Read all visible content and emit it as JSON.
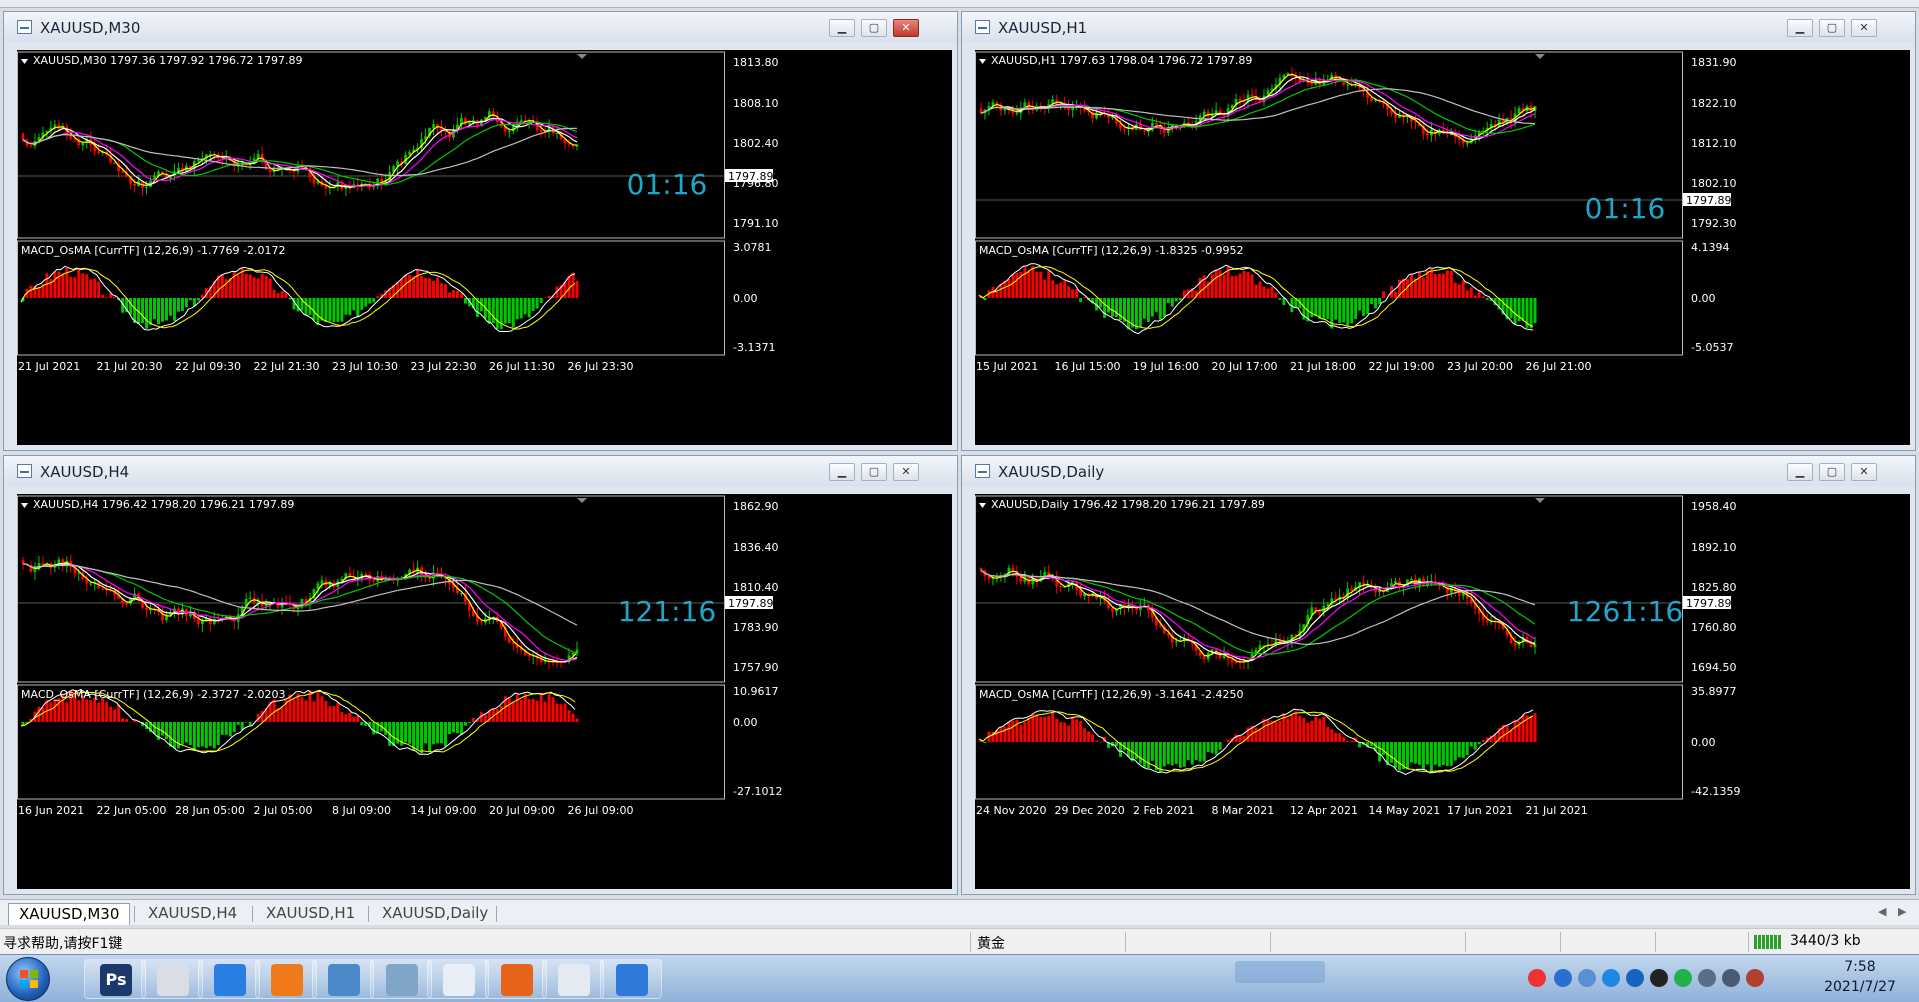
{
  "windows": [
    {
      "title": "XAUUSD,M30",
      "ohlc": "XAUUSD,M30  1797.36 1797.92 1796.72 1797.89",
      "price_axis": [
        "1813.80",
        "1808.10",
        "1802.40",
        "1796.80",
        "1791.10"
      ],
      "current_price": "1797.89",
      "countdown": "01:16",
      "macd": "MACD_OsMA [CurrTF] (12,26,9) -1.7769 -2.0172",
      "macd_axis": [
        "3.0781",
        "0.00",
        "-3.1371"
      ],
      "time_axis": [
        "21 Jul 2021",
        "21 Jul 20:30",
        "22 Jul 09:30",
        "22 Jul 21:30",
        "23 Jul 10:30",
        "23 Jul 22:30",
        "26 Jul 11:30",
        "26 Jul 23:30"
      ]
    },
    {
      "title": "XAUUSD,H1",
      "ohlc": "XAUUSD,H1  1797.63 1798.04 1796.72 1797.89",
      "price_axis": [
        "1831.90",
        "1822.10",
        "1812.10",
        "1802.10",
        "1792.30"
      ],
      "current_price": "1797.89",
      "countdown": "01:16",
      "macd": "MACD_OsMA [CurrTF] (12,26,9) -1.8325 -0.9952",
      "macd_axis": [
        "4.1394",
        "0.00",
        "-5.0537"
      ],
      "time_axis": [
        "15 Jul 2021",
        "16 Jul 15:00",
        "19 Jul 16:00",
        "20 Jul 17:00",
        "21 Jul 18:00",
        "22 Jul 19:00",
        "23 Jul 20:00",
        "26 Jul 21:00"
      ]
    },
    {
      "title": "XAUUSD,H4",
      "ohlc": "XAUUSD,H4  1796.42 1798.20 1796.21 1797.89",
      "price_axis": [
        "1862.90",
        "1836.40",
        "1810.40",
        "1783.90",
        "1757.90"
      ],
      "current_price": "1797.89",
      "countdown": "121:16",
      "macd": "MACD_OsMA [CurrTF] (12,26,9) -2.3727 -2.0203",
      "macd_axis": [
        "10.9617",
        "0.00",
        "-27.1012"
      ],
      "time_axis": [
        "16 Jun 2021",
        "22 Jun 05:00",
        "28 Jun 05:00",
        "2 Jul 05:00",
        "8 Jul 09:00",
        "14 Jul 09:00",
        "20 Jul 09:00",
        "26 Jul 09:00"
      ]
    },
    {
      "title": "XAUUSD,Daily",
      "ohlc": "XAUUSD,Daily  1796.42 1798.20 1796.21 1797.89",
      "price_axis": [
        "1958.40",
        "1892.10",
        "1825.80",
        "1760.80",
        "1694.50"
      ],
      "current_price": "1797.89",
      "countdown": "1261:16",
      "macd": "MACD_OsMA [CurrTF] (12,26,9) -3.1641 -2.4250",
      "macd_axis": [
        "35.8977",
        "0.00",
        "-42.1359"
      ],
      "time_axis": [
        "24 Nov 2020",
        "29 Dec 2020",
        "2 Feb 2021",
        "8 Mar 2021",
        "12 Apr 2021",
        "14 May 2021",
        "17 Jun 2021",
        "21 Jul 2021"
      ]
    }
  ],
  "tabs": [
    "XAUUSD,M30",
    "XAUUSD,H4",
    "XAUUSD,H1",
    "XAUUSD,Daily"
  ],
  "status": {
    "help": "寻求帮助,请按F1键",
    "profile": "黄金",
    "traffic": "3440/3 kb"
  },
  "clock": {
    "time": "7:58",
    "date": "2021/7/27"
  },
  "taskbar_apps": [
    {
      "icon": "photoshop-icon",
      "label": "Ps",
      "color": "#1b3a6b"
    },
    {
      "icon": "figure-icon",
      "label": "",
      "color": "#d9dee6"
    },
    {
      "icon": "cloud-app-icon",
      "label": "",
      "color": "#2a7de1"
    },
    {
      "icon": "browser-icon",
      "label": "",
      "color": "#f07a1a"
    },
    {
      "icon": "contacts-icon",
      "label": "",
      "color": "#4b89c8"
    },
    {
      "icon": "notebook-icon",
      "label": "",
      "color": "#7fa6c9"
    },
    {
      "icon": "paint-icon",
      "label": "",
      "color": "#e7eef6"
    },
    {
      "icon": "stocks-app-icon",
      "label": "",
      "color": "#e8631a"
    },
    {
      "icon": "wechat-icon",
      "label": "",
      "color": "#e3eaf1"
    },
    {
      "icon": "phone-icon",
      "label": "",
      "color": "#2f7ad9"
    }
  ],
  "colors": {
    "bull": "#00c800",
    "bear": "#ff0000",
    "ma_fast": "#ffff00",
    "ma_mid": "#ff00ff",
    "ma_slow": "#00c800",
    "ma_long": "#c0c0c0",
    "countdown": "#1ea7c8"
  }
}
